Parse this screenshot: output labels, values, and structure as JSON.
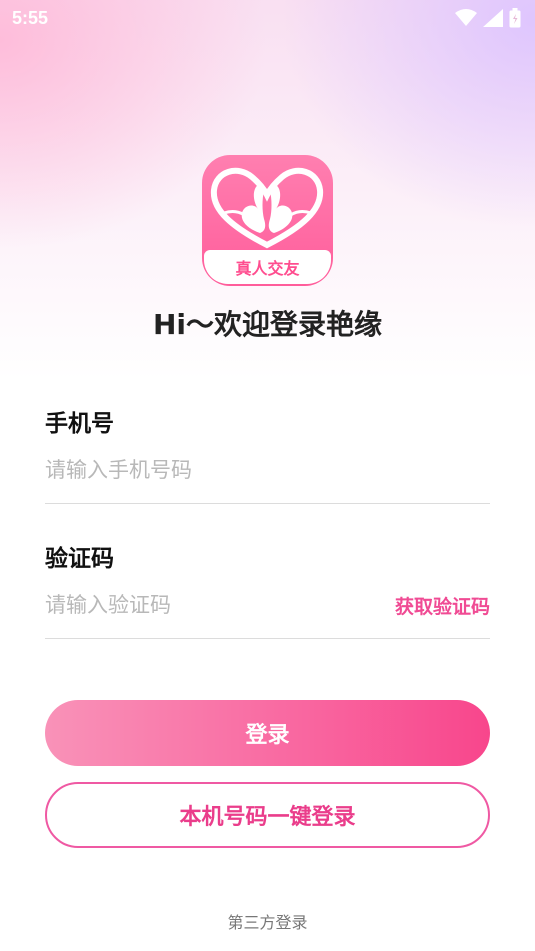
{
  "status_bar": {
    "time": "5:55",
    "icons": [
      "wifi-icon",
      "signal-icon",
      "battery-icon"
    ]
  },
  "logo": {
    "banner_text": "真人交友",
    "colors": {
      "primary": "#ff5d9b",
      "banner_text": "#ff4d8f"
    }
  },
  "welcome_text": "Hi～欢迎登录艳缘",
  "phone": {
    "label": "手机号",
    "placeholder": "请输入手机号码",
    "value": ""
  },
  "code": {
    "label": "验证码",
    "placeholder": "请输入验证码",
    "value": "",
    "get_code_label": "获取验证码"
  },
  "buttons": {
    "login": "登录",
    "one_key_login": "本机号码一键登录"
  },
  "third_party_label": "第三方登录",
  "colors": {
    "accent": "#f04b94",
    "login_gradient_start": "#f992b8",
    "login_gradient_end": "#f8468c",
    "one_key_border": "#ef59a3"
  }
}
